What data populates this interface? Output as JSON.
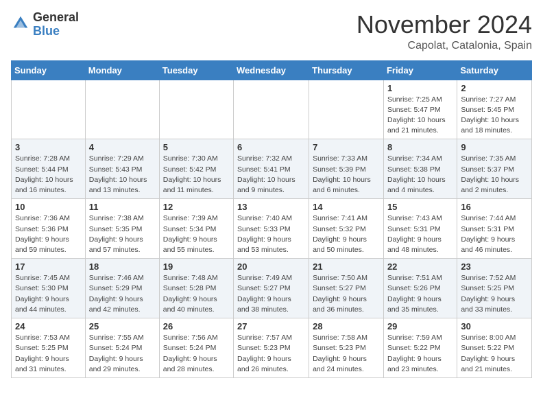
{
  "header": {
    "logo_general": "General",
    "logo_blue": "Blue",
    "month": "November 2024",
    "location": "Capolat, Catalonia, Spain"
  },
  "days_of_week": [
    "Sunday",
    "Monday",
    "Tuesday",
    "Wednesday",
    "Thursday",
    "Friday",
    "Saturday"
  ],
  "weeks": [
    [
      {
        "day": "",
        "info": ""
      },
      {
        "day": "",
        "info": ""
      },
      {
        "day": "",
        "info": ""
      },
      {
        "day": "",
        "info": ""
      },
      {
        "day": "",
        "info": ""
      },
      {
        "day": "1",
        "info": "Sunrise: 7:25 AM\nSunset: 5:47 PM\nDaylight: 10 hours and 21 minutes."
      },
      {
        "day": "2",
        "info": "Sunrise: 7:27 AM\nSunset: 5:45 PM\nDaylight: 10 hours and 18 minutes."
      }
    ],
    [
      {
        "day": "3",
        "info": "Sunrise: 7:28 AM\nSunset: 5:44 PM\nDaylight: 10 hours and 16 minutes."
      },
      {
        "day": "4",
        "info": "Sunrise: 7:29 AM\nSunset: 5:43 PM\nDaylight: 10 hours and 13 minutes."
      },
      {
        "day": "5",
        "info": "Sunrise: 7:30 AM\nSunset: 5:42 PM\nDaylight: 10 hours and 11 minutes."
      },
      {
        "day": "6",
        "info": "Sunrise: 7:32 AM\nSunset: 5:41 PM\nDaylight: 10 hours and 9 minutes."
      },
      {
        "day": "7",
        "info": "Sunrise: 7:33 AM\nSunset: 5:39 PM\nDaylight: 10 hours and 6 minutes."
      },
      {
        "day": "8",
        "info": "Sunrise: 7:34 AM\nSunset: 5:38 PM\nDaylight: 10 hours and 4 minutes."
      },
      {
        "day": "9",
        "info": "Sunrise: 7:35 AM\nSunset: 5:37 PM\nDaylight: 10 hours and 2 minutes."
      }
    ],
    [
      {
        "day": "10",
        "info": "Sunrise: 7:36 AM\nSunset: 5:36 PM\nDaylight: 9 hours and 59 minutes."
      },
      {
        "day": "11",
        "info": "Sunrise: 7:38 AM\nSunset: 5:35 PM\nDaylight: 9 hours and 57 minutes."
      },
      {
        "day": "12",
        "info": "Sunrise: 7:39 AM\nSunset: 5:34 PM\nDaylight: 9 hours and 55 minutes."
      },
      {
        "day": "13",
        "info": "Sunrise: 7:40 AM\nSunset: 5:33 PM\nDaylight: 9 hours and 53 minutes."
      },
      {
        "day": "14",
        "info": "Sunrise: 7:41 AM\nSunset: 5:32 PM\nDaylight: 9 hours and 50 minutes."
      },
      {
        "day": "15",
        "info": "Sunrise: 7:43 AM\nSunset: 5:31 PM\nDaylight: 9 hours and 48 minutes."
      },
      {
        "day": "16",
        "info": "Sunrise: 7:44 AM\nSunset: 5:31 PM\nDaylight: 9 hours and 46 minutes."
      }
    ],
    [
      {
        "day": "17",
        "info": "Sunrise: 7:45 AM\nSunset: 5:30 PM\nDaylight: 9 hours and 44 minutes."
      },
      {
        "day": "18",
        "info": "Sunrise: 7:46 AM\nSunset: 5:29 PM\nDaylight: 9 hours and 42 minutes."
      },
      {
        "day": "19",
        "info": "Sunrise: 7:48 AM\nSunset: 5:28 PM\nDaylight: 9 hours and 40 minutes."
      },
      {
        "day": "20",
        "info": "Sunrise: 7:49 AM\nSunset: 5:27 PM\nDaylight: 9 hours and 38 minutes."
      },
      {
        "day": "21",
        "info": "Sunrise: 7:50 AM\nSunset: 5:27 PM\nDaylight: 9 hours and 36 minutes."
      },
      {
        "day": "22",
        "info": "Sunrise: 7:51 AM\nSunset: 5:26 PM\nDaylight: 9 hours and 35 minutes."
      },
      {
        "day": "23",
        "info": "Sunrise: 7:52 AM\nSunset: 5:25 PM\nDaylight: 9 hours and 33 minutes."
      }
    ],
    [
      {
        "day": "24",
        "info": "Sunrise: 7:53 AM\nSunset: 5:25 PM\nDaylight: 9 hours and 31 minutes."
      },
      {
        "day": "25",
        "info": "Sunrise: 7:55 AM\nSunset: 5:24 PM\nDaylight: 9 hours and 29 minutes."
      },
      {
        "day": "26",
        "info": "Sunrise: 7:56 AM\nSunset: 5:24 PM\nDaylight: 9 hours and 28 minutes."
      },
      {
        "day": "27",
        "info": "Sunrise: 7:57 AM\nSunset: 5:23 PM\nDaylight: 9 hours and 26 minutes."
      },
      {
        "day": "28",
        "info": "Sunrise: 7:58 AM\nSunset: 5:23 PM\nDaylight: 9 hours and 24 minutes."
      },
      {
        "day": "29",
        "info": "Sunrise: 7:59 AM\nSunset: 5:22 PM\nDaylight: 9 hours and 23 minutes."
      },
      {
        "day": "30",
        "info": "Sunrise: 8:00 AM\nSunset: 5:22 PM\nDaylight: 9 hours and 21 minutes."
      }
    ]
  ]
}
